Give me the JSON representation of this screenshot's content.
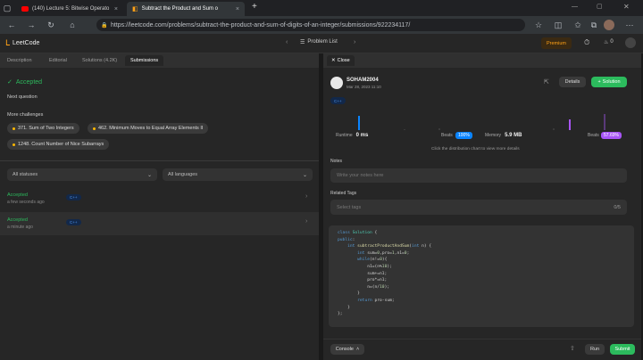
{
  "browser": {
    "tabs": [
      {
        "label": "(140) Lecture 5: Bitwise Operato",
        "close": "×"
      },
      {
        "label": "Subtract the Product and Sum o",
        "close": "×"
      }
    ],
    "new_tab": "+",
    "url": "https://leetcode.com/problems/subtract-the-product-and-sum-of-digits-of-an-integer/submissions/922234117/"
  },
  "header": {
    "logo": "LeetCode",
    "problem_list": "Problem List",
    "premium": "Premium",
    "fire_count": "0"
  },
  "left_tabs": [
    "Description",
    "Editorial",
    "Solutions (4.2K)",
    "Submissions"
  ],
  "result": {
    "status": "Accepted",
    "next_question": "Next question",
    "more_challenges": "More challenges",
    "challenges": [
      "371. Sum of Two Integers",
      "462. Minimum Moves to Equal Array Elements II",
      "1248. Count Number of Nice Subarrays"
    ]
  },
  "filters": {
    "status": "All statuses",
    "language": "All languages"
  },
  "submissions": [
    {
      "status": "Accepted",
      "time": "a few seconds ago",
      "lang": "C++"
    },
    {
      "status": "Accepted",
      "time": "a minute ago",
      "lang": "C++"
    }
  ],
  "detail": {
    "close": "Close",
    "user": "SOHAM2004",
    "date": "Mar 28, 2023 11:10",
    "details_btn": "Details",
    "solution_btn": "Solution",
    "lang": "C++",
    "runtime_label": "Runtime",
    "runtime_value": "0 ms",
    "beats_label": "Beats",
    "runtime_beats": "100%",
    "memory_label": "Memory",
    "memory_value": "5.9 MB",
    "memory_beats": "57.69%",
    "hint": "Click the distribution chart to view more details",
    "notes_label": "Notes",
    "notes_placeholder": "Write your notes here",
    "tags_label": "Related Tags",
    "tags_placeholder": "Select tags",
    "tags_count": "0/5",
    "console": "Console",
    "run": "Run",
    "submit": "Submit"
  },
  "code_lines": [
    "class Solution {",
    "public:",
    "    int subtractProductAndSum(int n) {",
    "        int sum=0,pro=1,n1=0;",
    "        while(n!=0){",
    "            n1=(n%10);",
    "            sum+=n1;",
    "            pro*=n1;",
    "            n=(n/10);",
    "        }",
    "        return pro-sum;",
    "    }",
    "};"
  ],
  "colors": {
    "accent_green": "#2cbb5d",
    "accent_blue": "#0a84ff",
    "accent_purple": "#a855f7",
    "bg": "#1a1a1a"
  }
}
